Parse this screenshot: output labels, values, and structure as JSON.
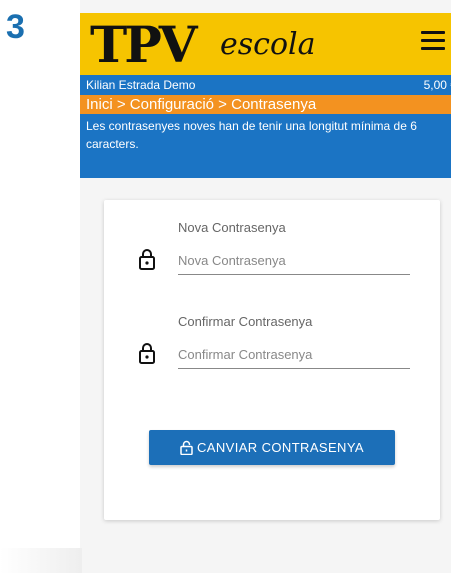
{
  "step_number": "3",
  "header": {
    "logo_main": "TPV",
    "logo_sub": "escola",
    "menu_icon": "hamburger-menu-icon"
  },
  "userbar": {
    "user_name": "Kilian Estrada Demo",
    "balance": "5,00 €"
  },
  "breadcrumb": {
    "items": [
      "Inici",
      "Configuració",
      "Contrasenya"
    ],
    "separator": " > "
  },
  "notice": {
    "text": "Les contrasenyes noves han de tenir una longitut mínima de 6 caracters."
  },
  "form": {
    "new_password": {
      "label": "Nova Contrasenya",
      "placeholder": "Nova Contrasenya",
      "icon": "lock-icon"
    },
    "confirm_password": {
      "label": "Confirmar Contrasenya",
      "placeholder": "Confirmar Contrasenya",
      "icon": "lock-icon"
    },
    "submit_label": "CANVIAR CONTRASENYA",
    "submit_icon": "lock-open-icon"
  },
  "colors": {
    "header_yellow": "#f6c400",
    "primary_blue": "#1b74c4",
    "breadcrumb_orange": "#f39220",
    "step_blue": "#1a6fb0"
  }
}
